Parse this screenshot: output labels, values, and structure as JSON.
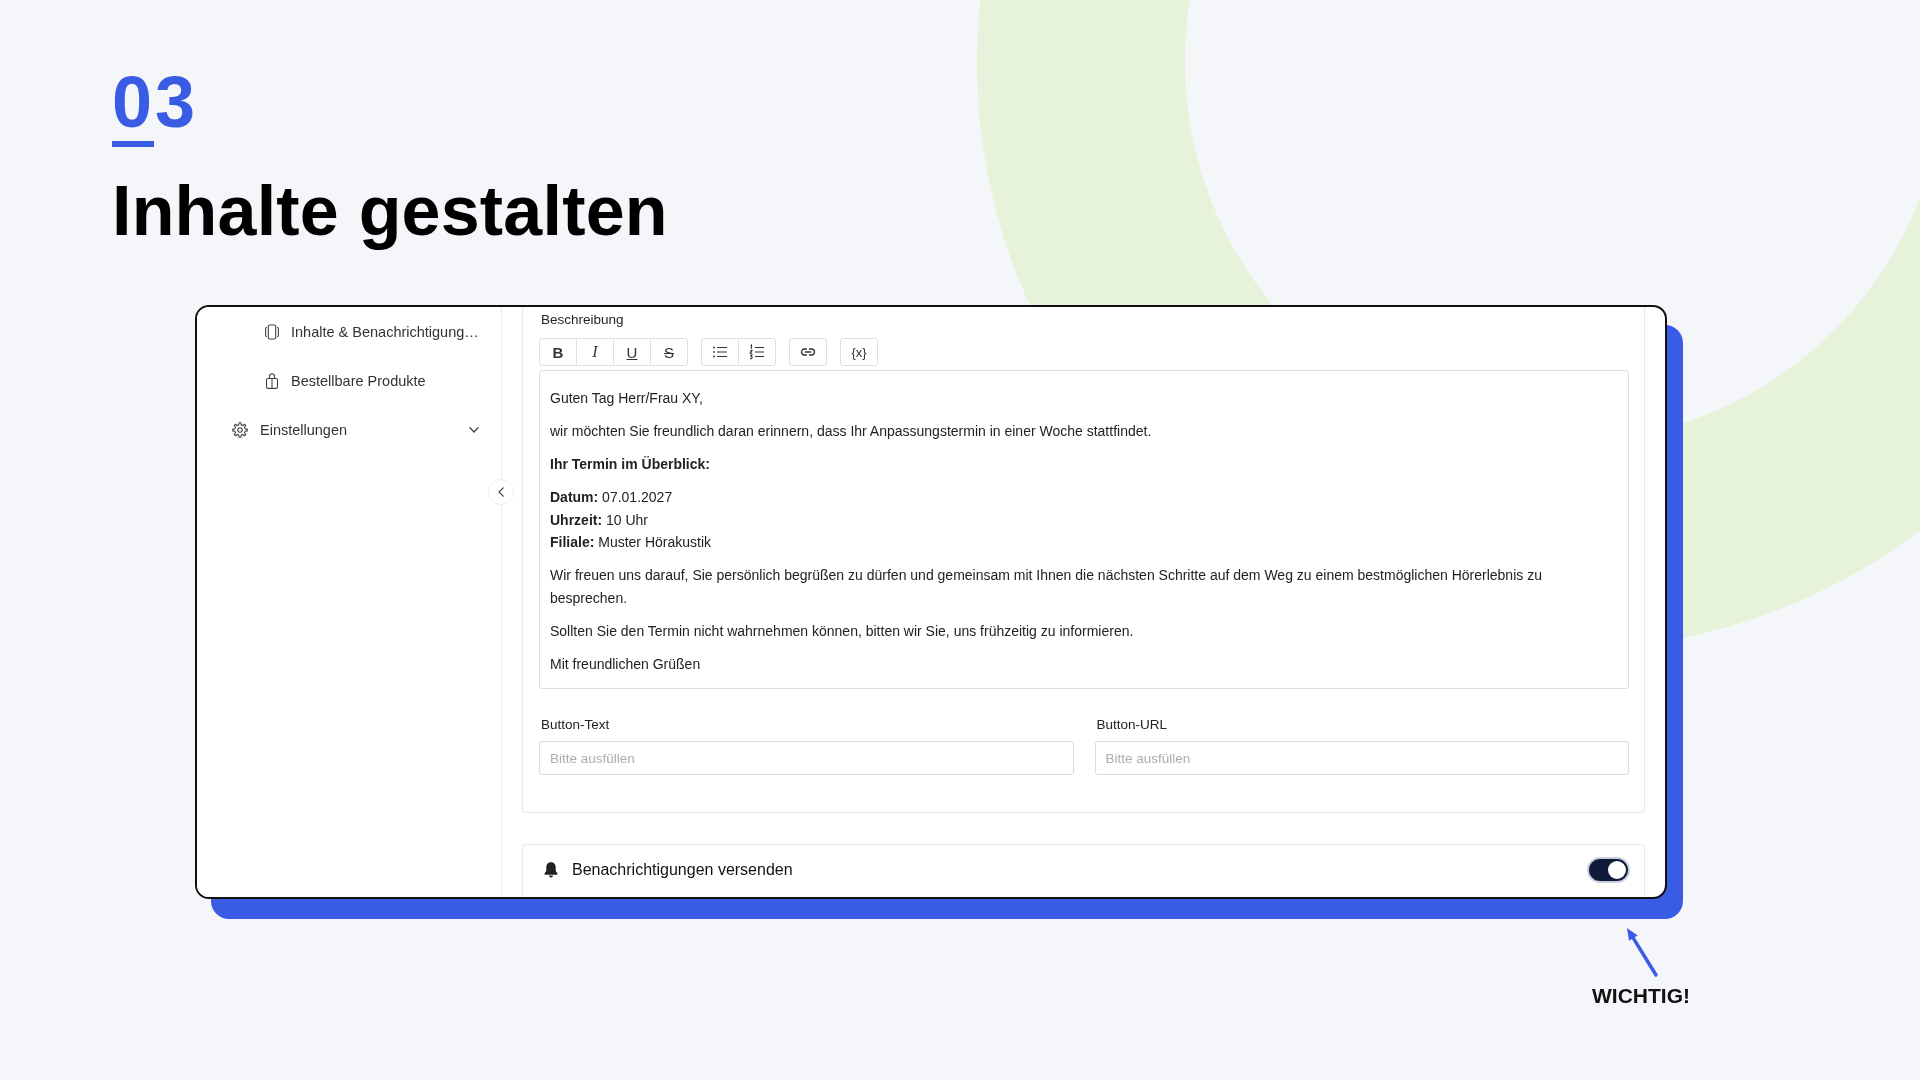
{
  "header": {
    "number": "03",
    "title": "Inhalte gestalten"
  },
  "sidebar": {
    "sub_items": [
      {
        "kind": "contents",
        "label": "Inhalte & Benachrichtigung…"
      },
      {
        "kind": "products",
        "label": "Bestellbare Produkte"
      }
    ],
    "items": [
      {
        "kind": "settings",
        "label": "Einstellungen",
        "expanded": false
      }
    ]
  },
  "description": {
    "label": "Beschreibung",
    "toolbar": {
      "groups": [
        {
          "buttons": [
            {
              "kind": "bold",
              "label": "B"
            },
            {
              "kind": "italic",
              "label": "I"
            },
            {
              "kind": "underline",
              "label": "U"
            },
            {
              "kind": "strikethrough",
              "label": "S"
            }
          ]
        },
        {
          "buttons": [
            {
              "kind": "bullet_list"
            },
            {
              "kind": "numbered_list"
            }
          ]
        },
        {
          "buttons": [
            {
              "kind": "link"
            }
          ]
        },
        {
          "buttons": [
            {
              "kind": "variable",
              "label": "{x}"
            }
          ]
        }
      ]
    },
    "editor": {
      "paragraphs": [
        {
          "kind": "text",
          "text": "Guten Tag Herr/Frau XY,"
        },
        {
          "kind": "text",
          "text": "wir möchten Sie freundlich daran erinnern, dass Ihr Anpassungstermin in einer Woche stattfindet."
        },
        {
          "kind": "heading",
          "text": "Ihr Termin im Überblick:"
        },
        {
          "kind": "lines",
          "lines": [
            "**Datum:** 07.01.2027",
            "**Uhrzeit:** 10 Uhr",
            "**Filiale:** Muster Hörakustik"
          ]
        },
        {
          "kind": "text",
          "text": "Wir freuen uns darauf, Sie persönlich begrüßen zu dürfen und gemeinsam mit Ihnen die nächsten Schritte auf dem Weg zu einem bestmöglichen Hörerlebnis zu besprechen."
        },
        {
          "kind": "text",
          "text": "Sollten Sie den Termin nicht wahrnehmen können, bitten wir Sie, uns frühzeitig zu informieren."
        },
        {
          "kind": "text",
          "text": "Mit freundlichen Grüßen"
        }
      ]
    }
  },
  "fields": [
    {
      "label": "Button-Text",
      "placeholder": "Bitte ausfüllen"
    },
    {
      "label": "Button-URL",
      "placeholder": "Bitte ausfüllen"
    }
  ],
  "notifications": {
    "label": "Benachrichtigungen versenden",
    "on": true
  },
  "annotation": {
    "text": "WICHTIG!"
  }
}
